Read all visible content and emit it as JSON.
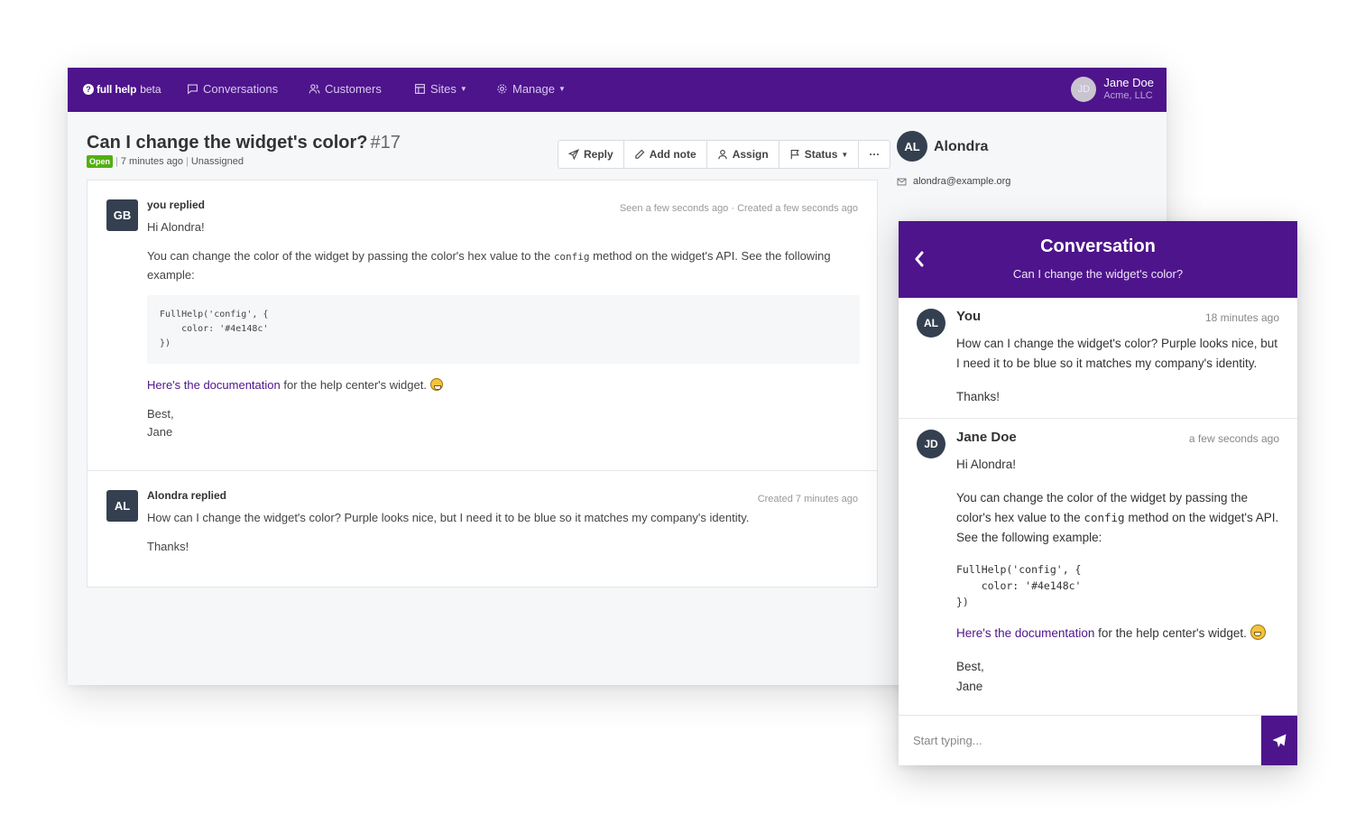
{
  "navbar": {
    "brand_name": "full help",
    "brand_tag": "beta",
    "items": [
      {
        "label": "Conversations"
      },
      {
        "label": "Customers"
      },
      {
        "label": "Sites"
      },
      {
        "label": "Manage"
      }
    ],
    "user": {
      "initials": "JD",
      "name": "Jane Doe",
      "org": "Acme, LLC"
    }
  },
  "conversation": {
    "title": "Can I change the widget's color?",
    "number": "#17",
    "status": "Open",
    "age": "7 minutes ago",
    "assignee": "Unassigned",
    "toolbar": {
      "reply": "Reply",
      "add_note": "Add note",
      "assign": "Assign",
      "status": "Status",
      "more": "···"
    },
    "messages": [
      {
        "initials": "GB",
        "author": "you replied",
        "info": "Seen a few seconds ago · Created a few seconds ago",
        "greeting": "Hi Alondra!",
        "p1_before": "You can change the color of the widget by passing the color's hex value to the ",
        "p1_code": "config",
        "p1_after": " method on the widget's API. See the following example:",
        "code": "FullHelp('config', {\n    color: '#4e148c'\n})",
        "link": "Here's the documentation",
        "link_after": " for the help center's widget. ",
        "signoff": "Best,",
        "signature": "Jane"
      },
      {
        "initials": "AL",
        "author": "Alondra replied",
        "info": "Created 7 minutes ago",
        "text": "How can I change the widget's color? Purple looks nice, but I need it to be blue so it matches my company's identity.",
        "thanks": "Thanks!"
      }
    ]
  },
  "customer": {
    "initials": "AL",
    "name": "Alondra",
    "email": "alondra@example.org"
  },
  "widget": {
    "title": "Conversation",
    "subtitle": "Can I change the widget's color?",
    "messages": [
      {
        "initials": "AL",
        "author": "You",
        "time": "18 minutes ago",
        "text": "How can I change the widget's color? Purple looks nice, but I need it to be blue so it matches my company's identity.",
        "thanks": "Thanks!"
      },
      {
        "initials": "JD",
        "author": "Jane Doe",
        "time": "a few seconds ago",
        "greeting": "Hi Alondra!",
        "p1_before": "You can change the color of the widget by passing the color's hex value to the ",
        "p1_code": "config",
        "p1_after": " method on the widget's API. See the following example:",
        "code": "FullHelp('config', {\n    color: '#4e148c'\n})",
        "link": "Here's the documentation",
        "link_after": " for the help center's widget. ",
        "signoff": "Best,",
        "signature": "Jane"
      }
    ],
    "input_placeholder": "Start typing..."
  },
  "colors": {
    "brand": "#4e148c",
    "open_badge": "#52b011",
    "avatar_dark": "#344050"
  }
}
